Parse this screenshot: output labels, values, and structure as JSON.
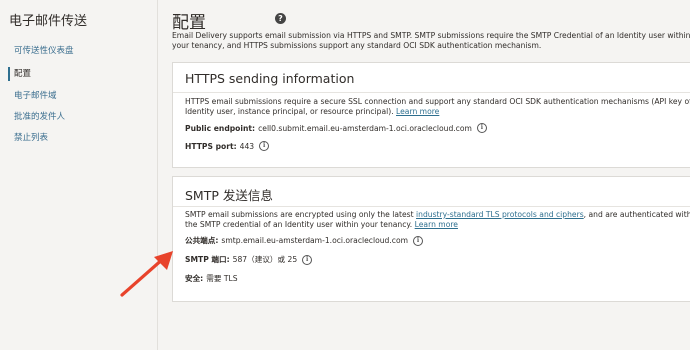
{
  "sidebar": {
    "title": "电子邮件传送",
    "items": [
      {
        "label": "可传送性仪表盘"
      },
      {
        "label": "配置"
      },
      {
        "label": "电子邮件域"
      },
      {
        "label": "批准的发件人"
      },
      {
        "label": "禁止列表"
      }
    ]
  },
  "main": {
    "title": "配置",
    "help_icon": "?",
    "intro": "Email Delivery supports email submission via HTTPS and SMTP. SMTP submissions require the SMTP Credential of an Identity user within your tenancy, and HTTPS submissions support any standard OCI SDK authentication mechanism."
  },
  "https_card": {
    "title": "HTTPS sending information",
    "desc": "HTTPS email submissions require a secure SSL connection and support any standard OCI SDK authentication mechanisms (API key of an Identity user, instance principal, or resource principal).",
    "learn_more": "Learn more",
    "endpoint_label": "Public endpoint:",
    "endpoint_value": "cell0.submit.email.eu-amsterdam-1.oci.oraclecloud.com",
    "port_label": "HTTPS port:",
    "port_value": "443"
  },
  "smtp_card": {
    "title": "SMTP 发送信息",
    "desc_before": "SMTP email submissions are encrypted using only the latest",
    "desc_link": "industry-standard TLS protocols and ciphers",
    "desc_after": ", and are authenticated with the SMTP credential of an Identity user within your tenancy.",
    "learn_more": "Learn more",
    "endpoint_label": "公共端点:",
    "endpoint_value": "smtp.email.eu-amsterdam-1.oci.oraclecloud.com",
    "port_label": "SMTP 端口:",
    "port_value": "587（建议）或 25",
    "security_label": "安全:",
    "security_value": "需要 TLS"
  },
  "icons": {
    "info": "info-icon",
    "help": "help-icon",
    "annotation": "red-arrow"
  },
  "colors": {
    "link": "#2e6f8f",
    "arrow": "#e8432b",
    "background": "#f5f4f2"
  }
}
